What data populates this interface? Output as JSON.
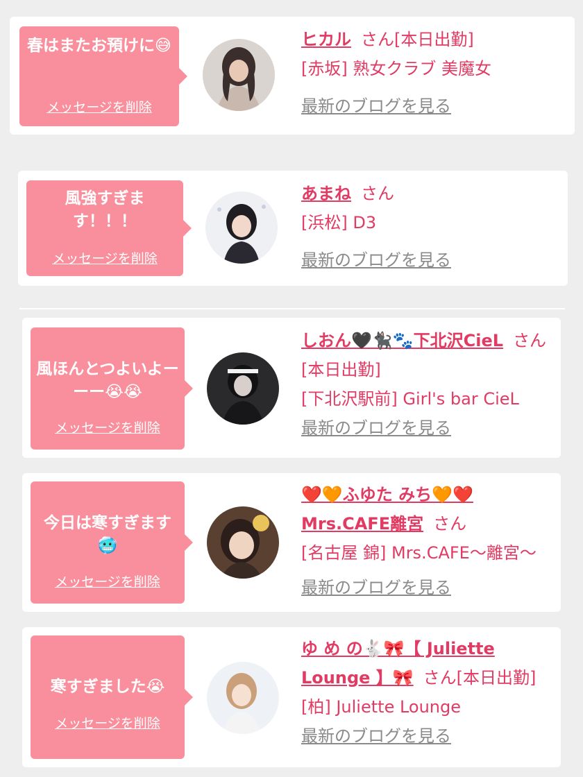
{
  "cards": [
    {
      "message": "春はまたお預けに😅",
      "delete_label": "メッセージを削除",
      "name": "ヒカル",
      "suffix": "さん[本日出勤]",
      "shop": "[赤坂] 熟女クラブ 美魔女",
      "blog_label": "最新のブログを見る"
    },
    {
      "message": "風強すぎます！！！",
      "delete_label": "メッセージを削除",
      "name": "あまね",
      "suffix": "さん",
      "shop": "[浜松] D3",
      "blog_label": "最新のブログを見る"
    },
    {
      "message": "風ほんとつよいよーーー😭😭",
      "delete_label": "メッセージを削除",
      "name": "しおん🖤🐈‍⬛🐾下北沢CieL",
      "suffix": "さん[本日出勤]",
      "shop": "[下北沢駅前] Girl's bar CieL",
      "blog_label": "最新のブログを見る"
    },
    {
      "message": "今日は寒すぎます🥶",
      "delete_label": "メッセージを削除",
      "name": "❤️🧡ふゆた みち🧡❤️ Mrs.CAFE離宮",
      "suffix": "さん",
      "shop": "[名古屋 錦] Mrs.CAFE〜離宮〜",
      "blog_label": "最新のブログを見る"
    },
    {
      "message": "寒すぎました😭",
      "delete_label": "メッセージを削除",
      "name": "ゆ め の🐇🎀【 Juliette Lounge 】🎀",
      "suffix": "さん[本日出勤]",
      "shop": "[柏] Juliette Lounge",
      "blog_label": "最新のブログを見る"
    }
  ],
  "colors": {
    "bubble": "#f98f9c",
    "accent": "#e23b63",
    "link_gray": "#8a8a8a",
    "background": "#eeeeee"
  }
}
